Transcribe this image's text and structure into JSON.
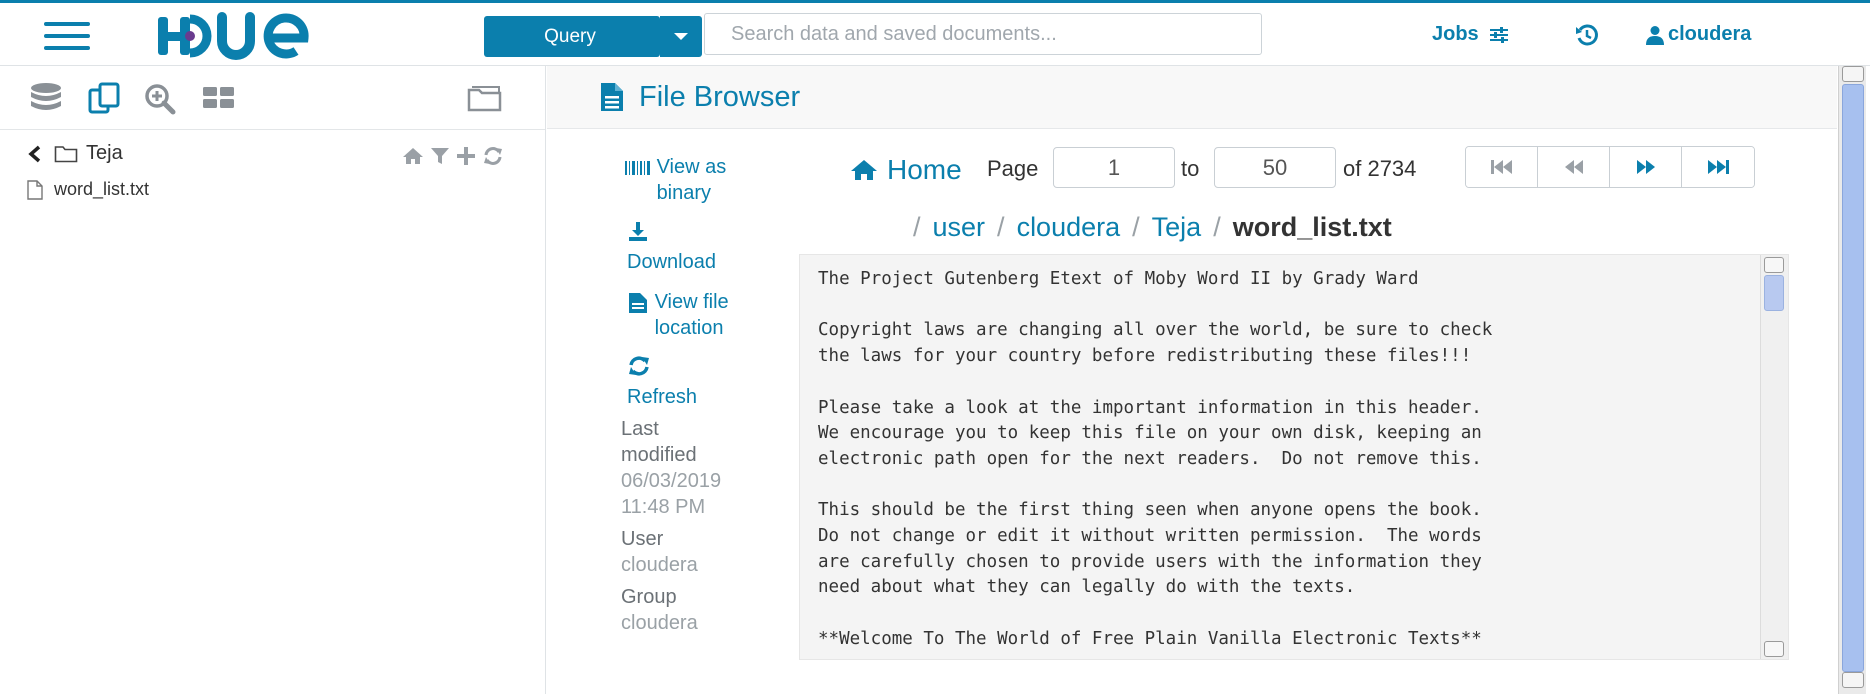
{
  "app": {
    "name": "Hue",
    "accent": "#0b7fad"
  },
  "topbar": {
    "query_label": "Query",
    "search_placeholder": "Search data and saved documents...",
    "jobs_label": "Jobs",
    "username": "cloudera"
  },
  "left_panel": {
    "icons": [
      "database-icon",
      "documents-icon",
      "search-plus-icon",
      "dashboard-icon",
      "folder-open-icon"
    ],
    "folder_name": "Teja",
    "file_name": "word_list.txt"
  },
  "main": {
    "title": "File Browser",
    "actions": {
      "view_binary": "View as binary",
      "download": "Download",
      "view_location": "View file location",
      "refresh": "Refresh"
    },
    "meta": {
      "last_modified_label": "Last modified",
      "last_modified_value": "06/03/2019 11:48 PM",
      "user_label": "User",
      "user_value": "cloudera",
      "group_label": "Group",
      "group_value": "cloudera"
    },
    "pagination": {
      "home_label": "Home",
      "page_label": "Page",
      "from": "1",
      "to_label": "to",
      "to": "50",
      "of_label": "of 2734"
    },
    "breadcrumb": [
      "user",
      "cloudera",
      "Teja"
    ],
    "breadcrumb_current": "word_list.txt",
    "file_content": "The Project Gutenberg Etext of Moby Word II by Grady Ward\n\nCopyright laws are changing all over the world, be sure to check\nthe laws for your country before redistributing these files!!!\n\nPlease take a look at the important information in this header.\nWe encourage you to keep this file on your own disk, keeping an\nelectronic path open for the next readers.  Do not remove this.\n\nThis should be the first thing seen when anyone opens the book.\nDo not change or edit it without written permission.  The words\nare carefully chosen to provide users with the information they\nneed about what they can legally do with the texts.\n\n**Welcome To The World of Free Plain Vanilla Electronic Texts**"
  }
}
